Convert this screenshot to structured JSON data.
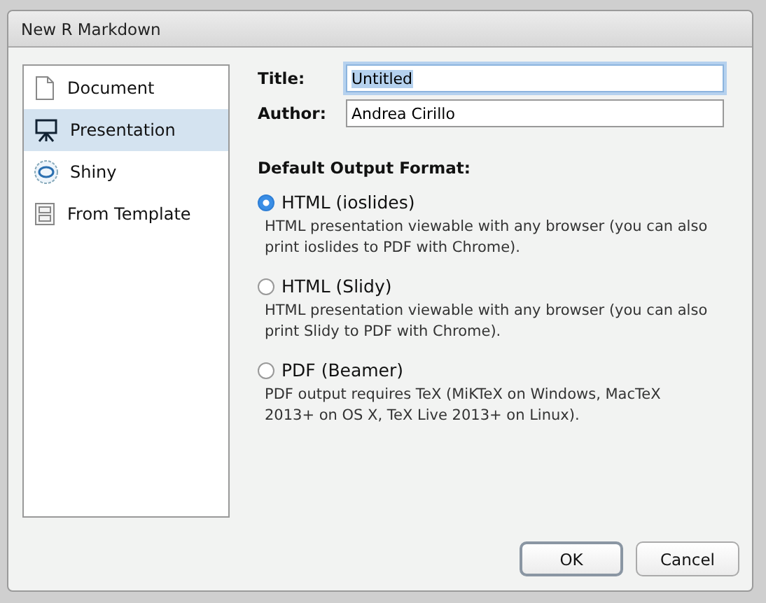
{
  "window": {
    "title": "New R Markdown"
  },
  "sidebar": {
    "items": [
      {
        "label": "Document",
        "selected": false
      },
      {
        "label": "Presentation",
        "selected": true
      },
      {
        "label": "Shiny",
        "selected": false
      },
      {
        "label": "From Template",
        "selected": false
      }
    ]
  },
  "fields": [
    {
      "label": "Title:",
      "value": "Untitled",
      "focused": true
    },
    {
      "label": "Author:",
      "value": "Andrea Cirillo",
      "focused": false
    }
  ],
  "output_format": {
    "heading": "Default Output Format:",
    "options": [
      {
        "label": "HTML (ioslides)",
        "description": "HTML presentation viewable with any browser (you can also print ioslides to PDF with Chrome).",
        "selected": true
      },
      {
        "label": "HTML (Slidy)",
        "description": "HTML presentation viewable with any browser (you can also print Slidy to PDF with Chrome).",
        "selected": false
      },
      {
        "label": "PDF (Beamer)",
        "description": "PDF output requires TeX (MiKTeX on Windows, MacTeX 2013+ on OS X, TeX Live 2013+ on Linux).",
        "selected": false
      }
    ]
  },
  "buttons": [
    {
      "label": "OK",
      "default": true
    },
    {
      "label": "Cancel",
      "default": false
    }
  ]
}
